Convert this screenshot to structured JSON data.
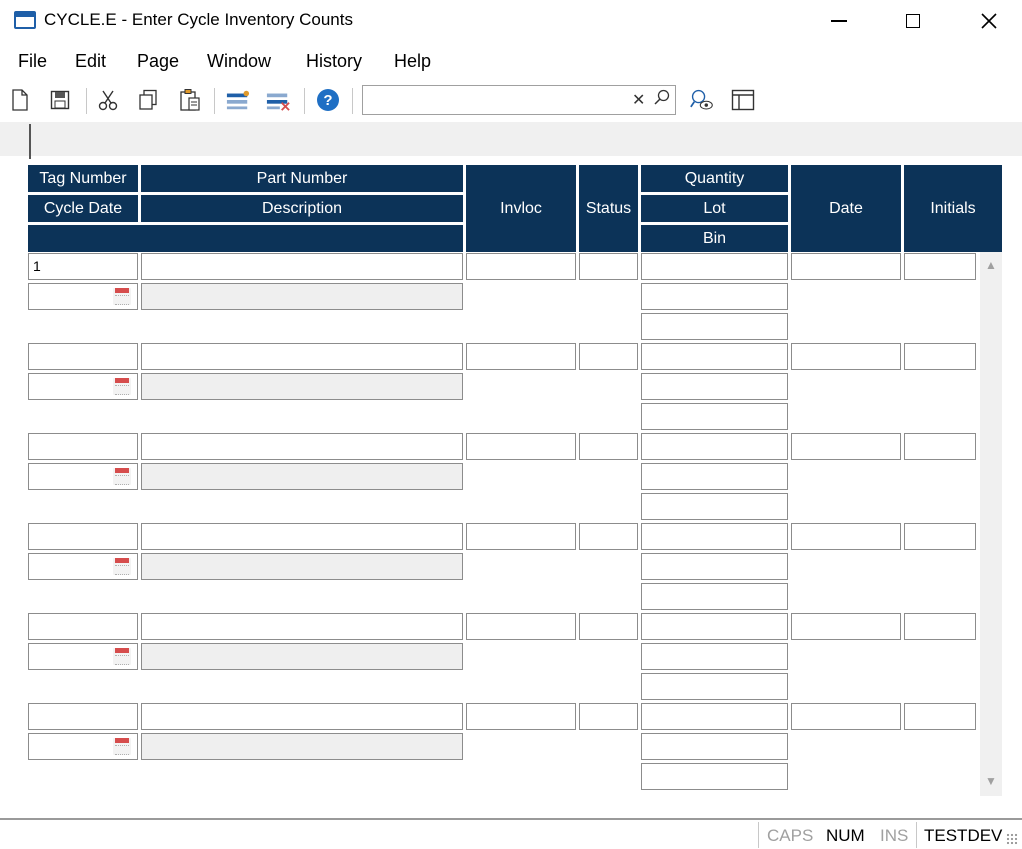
{
  "window": {
    "title": "CYCLE.E - Enter Cycle Inventory Counts"
  },
  "menu": [
    "File",
    "Edit",
    "Page",
    "Window",
    "History",
    "Help"
  ],
  "toolbar": {
    "search_value": ""
  },
  "grid": {
    "headers": {
      "tag_number": "Tag Number",
      "part_number": "Part Number",
      "cycle_date": "Cycle Date",
      "description": "Description",
      "invloc": "Invloc",
      "status": "Status",
      "quantity": "Quantity",
      "lot": "Lot",
      "bin": "Bin",
      "date": "Date",
      "initials": "Initials"
    },
    "rows": [
      {
        "tag_number": "1",
        "part_number": "",
        "cycle_date": "",
        "description": "",
        "invloc": "",
        "status": "",
        "quantity": "",
        "lot": "",
        "bin": "",
        "date": "",
        "initials": ""
      },
      {
        "tag_number": "",
        "part_number": "",
        "cycle_date": "",
        "description": "",
        "invloc": "",
        "status": "",
        "quantity": "",
        "lot": "",
        "bin": "",
        "date": "",
        "initials": ""
      },
      {
        "tag_number": "",
        "part_number": "",
        "cycle_date": "",
        "description": "",
        "invloc": "",
        "status": "",
        "quantity": "",
        "lot": "",
        "bin": "",
        "date": "",
        "initials": ""
      },
      {
        "tag_number": "",
        "part_number": "",
        "cycle_date": "",
        "description": "",
        "invloc": "",
        "status": "",
        "quantity": "",
        "lot": "",
        "bin": "",
        "date": "",
        "initials": ""
      },
      {
        "tag_number": "",
        "part_number": "",
        "cycle_date": "",
        "description": "",
        "invloc": "",
        "status": "",
        "quantity": "",
        "lot": "",
        "bin": "",
        "date": "",
        "initials": ""
      },
      {
        "tag_number": "",
        "part_number": "",
        "cycle_date": "",
        "description": "",
        "invloc": "",
        "status": "",
        "quantity": "",
        "lot": "",
        "bin": "",
        "date": "",
        "initials": ""
      }
    ]
  },
  "statusbar": {
    "caps": "CAPS",
    "num": "NUM",
    "ins": "INS",
    "env": "TESTDEV"
  },
  "colors": {
    "header_bg": "#0c3358",
    "accent_blue": "#1f5fa8",
    "calendar_red": "#d64d4d"
  }
}
